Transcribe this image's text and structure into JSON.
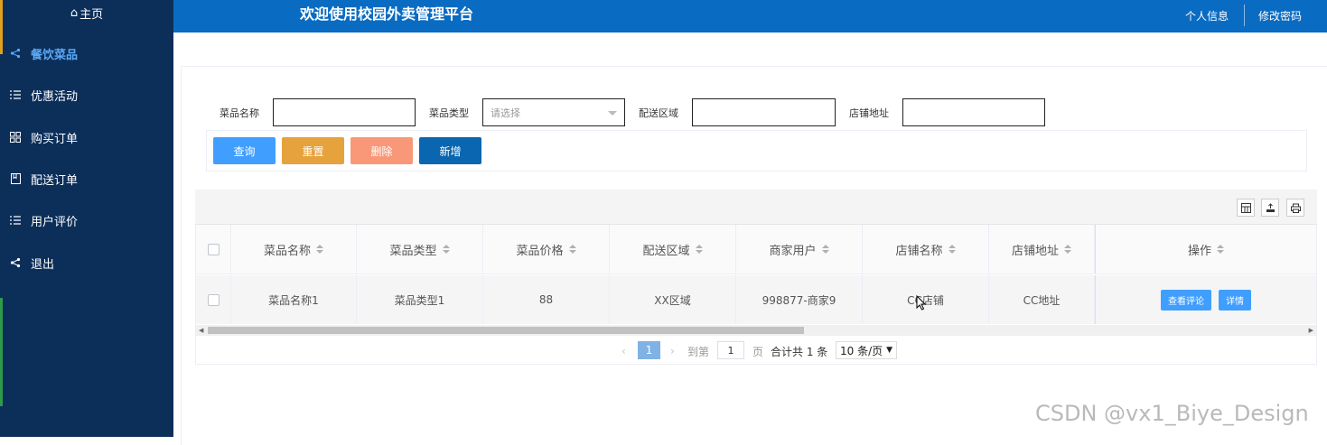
{
  "header": {
    "site_title": "欢迎使用校园外卖管理平台",
    "profile_link": "个人信息",
    "change_password_link": "修改密码"
  },
  "sidebar": {
    "home_label": "主页",
    "items": [
      {
        "label": "餐饮菜品",
        "icon": "share-icon",
        "active": true
      },
      {
        "label": "优惠活动",
        "icon": "list-icon",
        "active": false
      },
      {
        "label": "购买订单",
        "icon": "grid-icon",
        "active": false
      },
      {
        "label": "配送订单",
        "icon": "book-icon",
        "active": false
      },
      {
        "label": "用户评价",
        "icon": "list-icon",
        "active": false
      },
      {
        "label": "退出",
        "icon": "share-icon",
        "active": false
      }
    ]
  },
  "search": {
    "fields": [
      {
        "label": "菜品名称",
        "value": ""
      },
      {
        "label": "菜品类型",
        "placeholder": "请选择"
      },
      {
        "label": "配送区域",
        "value": ""
      },
      {
        "label": "店铺地址",
        "value": ""
      }
    ],
    "buttons": {
      "query": "查询",
      "reset": "重置",
      "delete": "删除",
      "add": "新增"
    }
  },
  "colors": {
    "sidebar_bg": "#0c2f5a",
    "topbar_bg": "#0a6bc2",
    "query_btn": "#409eff",
    "reset_btn": "#e6a23c",
    "delete_btn": "#f89878",
    "add_btn": "#0a66b0",
    "active_menu": "#5ca9f5"
  },
  "table": {
    "columns": [
      "菜品名称",
      "菜品类型",
      "菜品价格",
      "配送区域",
      "商家用户",
      "店铺名称",
      "店铺地址",
      "操作"
    ],
    "rows": [
      {
        "cells": [
          "菜品名称1",
          "菜品类型1",
          "88",
          "XX区域",
          "998877-商家9",
          "CC店铺",
          "CC地址"
        ],
        "actions": [
          "查看评论",
          "详情"
        ]
      }
    ],
    "toolbar_icons": [
      "columns-icon",
      "export-icon",
      "print-icon"
    ]
  },
  "pagination": {
    "current_page": "1",
    "goto_label": "到第",
    "goto_value": "1",
    "page_suffix": "页",
    "total_text": "合计共 1 条",
    "page_size": "10 条/页"
  },
  "watermark": "CSDN @vx1_Biye_Design"
}
